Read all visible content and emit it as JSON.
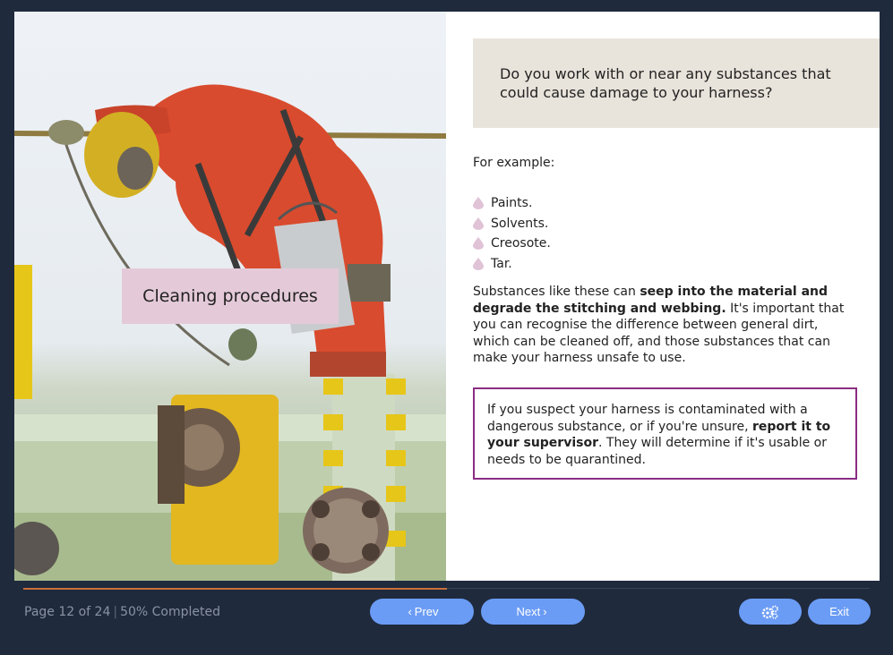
{
  "photo": {
    "label": "Cleaning procedures"
  },
  "question": {
    "text": "Do you work with or near any substances that could cause damage to your harness?"
  },
  "example_intro": "For example:",
  "examples": [
    "Paints.",
    "Solvents.",
    "Creosote.",
    "Tar."
  ],
  "paragraph": {
    "part1": "Substances like these can ",
    "bold": "seep into the material and degrade the stitching and webbing.",
    "part2": " It's important that you can recognise the difference between general dirt, which can be cleaned off, and those substances that can make your harness unsafe to use."
  },
  "callout": {
    "part1": "If you suspect your harness is contaminated with a dangerous substance, or if you're unsure, ",
    "bold": "report it to your supervisor",
    "part2": ". They will determine if it's usable or needs to be quarantined."
  },
  "footer": {
    "page": "Page 12 of 24",
    "separator": "|",
    "completed": "50% Completed",
    "prev_label": "Prev",
    "next_label": "Next",
    "exit_label": "Exit",
    "progress": 0.5
  },
  "colors": {
    "background": "#1f2a3d",
    "button": "#6b9cf5",
    "callout_border": "#8a2d83",
    "label_bg": "#e4cad8",
    "question_bg": "#e9e4db",
    "progress": "#c9703a",
    "bullet": "#e0c3d6"
  },
  "icons": {
    "bullet": "droplet-icon",
    "prev": "chevron-left-icon",
    "next": "chevron-right-icon",
    "settings": "gears-icon"
  }
}
